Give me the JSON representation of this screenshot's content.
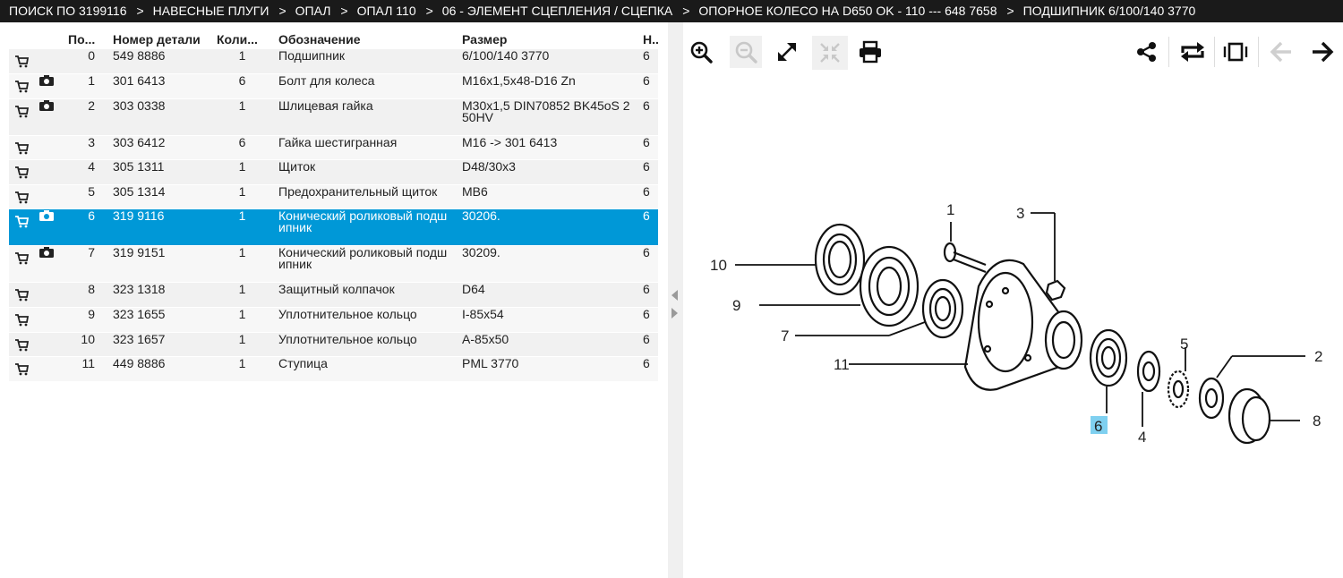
{
  "breadcrumb": [
    "ПОИСК ПО 3199116",
    "НАВЕСНЫЕ ПЛУГИ",
    "ОПАЛ",
    "ОПАЛ 110",
    "06 - ЭЛЕМЕНТ СЦЕПЛЕНИЯ / СЦЕПКА",
    "ОПОРНОЕ КОЛЕСО НА D650 OK - 110 --- 648 7658",
    "ПОДШИПНИК 6/100/140 3770"
  ],
  "breadcrumb_separator": ">",
  "table": {
    "headers": {
      "pos": "По...",
      "part_no": "Номер детали",
      "qty": "Коли...",
      "name": "Обозначение",
      "size": "Размер",
      "n": "Н..."
    },
    "rows": [
      {
        "pos": "0",
        "part_no": "549 8886",
        "qty": "1",
        "name": "Подшипник",
        "size": "6/100/140 3770",
        "n": "6",
        "photo": false
      },
      {
        "pos": "1",
        "part_no": "301 6413",
        "qty": "6",
        "name": "Болт для колеса",
        "size": "M16x1,5x48-D16 Zn",
        "n": "6",
        "photo": true
      },
      {
        "pos": "2",
        "part_no": "303 0338",
        "qty": "1",
        "name": "Шлицевая гайка",
        "size": "M30x1,5 DIN70852 BK45oS 2 50HV",
        "n": "6",
        "photo": true
      },
      {
        "pos": "3",
        "part_no": "303 6412",
        "qty": "6",
        "name": "Гайка шестигранная",
        "size": "M16 -> 301 6413",
        "n": "6",
        "photo": false
      },
      {
        "pos": "4",
        "part_no": "305 1311",
        "qty": "1",
        "name": "Щиток",
        "size": "D48/30x3",
        "n": "6",
        "photo": false
      },
      {
        "pos": "5",
        "part_no": "305 1314",
        "qty": "1",
        "name": "Предохранительный щиток",
        "size": "MB6",
        "n": "6",
        "photo": false
      },
      {
        "pos": "6",
        "part_no": "319 9116",
        "qty": "1",
        "name": "Конический роликовый подш ипник",
        "size": "30206.",
        "n": "6",
        "photo": true,
        "selected": true
      },
      {
        "pos": "7",
        "part_no": "319 9151",
        "qty": "1",
        "name": "Конический роликовый подш ипник",
        "size": "30209.",
        "n": "6",
        "photo": true
      },
      {
        "pos": "8",
        "part_no": "323 1318",
        "qty": "1",
        "name": "Защитный колпачок",
        "size": "D64",
        "n": "6",
        "photo": false
      },
      {
        "pos": "9",
        "part_no": "323 1655",
        "qty": "1",
        "name": "Уплотнительное кольцо",
        "size": "I-85x54",
        "n": "6",
        "photo": false
      },
      {
        "pos": "10",
        "part_no": "323 1657",
        "qty": "1",
        "name": "Уплотнительное кольцо",
        "size": "A-85x50",
        "n": "6",
        "photo": false
      },
      {
        "pos": "11",
        "part_no": "449 8886",
        "qty": "1",
        "name": "Ступица",
        "size": "PML 3770",
        "n": "6",
        "photo": false
      }
    ]
  },
  "toolbar": {
    "icons": [
      "zoom-in-icon",
      "zoom-out-icon",
      "expand-icon",
      "fit-icon",
      "print-icon",
      "share-icon",
      "swap-icon",
      "carousel-icon",
      "arrow-left-icon",
      "arrow-right-icon"
    ]
  },
  "diagram": {
    "callouts": [
      "1",
      "2",
      "3",
      "4",
      "5",
      "6",
      "7",
      "8",
      "9",
      "10",
      "11"
    ],
    "highlighted": "6"
  },
  "colors": {
    "selected_row": "#0098d7",
    "header_bar": "#1a1a1a",
    "highlight_label": "#7fd0f0"
  }
}
